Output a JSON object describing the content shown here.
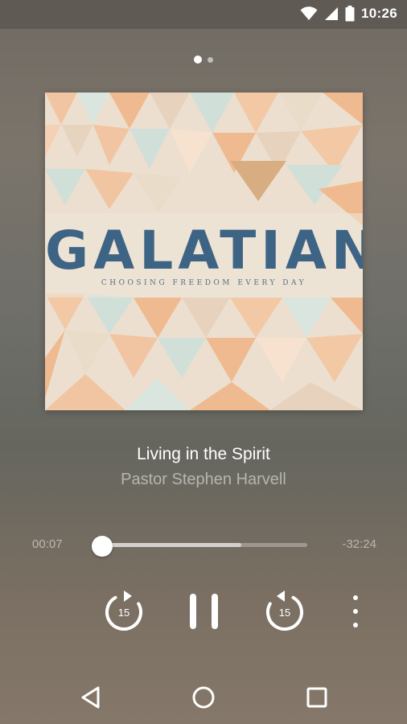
{
  "status_bar": {
    "time": "10:26",
    "icons": [
      "wifi-icon",
      "cell-signal-icon",
      "battery-icon"
    ]
  },
  "pager": {
    "pages": 2,
    "active_index": 0
  },
  "album_art": {
    "title": "GALATIANS",
    "subtitle": "CHOOSING FREEDOM EVERY DAY",
    "colors": {
      "title": "#3d6484",
      "peach": "#f0b98c",
      "cream": "#e9dccb",
      "mint": "#cfe0d8"
    }
  },
  "track": {
    "title": "Living in the Spirit",
    "artist": "Pastor Stephen Harvell"
  },
  "progress": {
    "elapsed": "00:07",
    "remaining": "-32:24",
    "played_fraction": 0.004,
    "buffered_fraction": 0.68
  },
  "controls": {
    "rewind_seconds": "15",
    "forward_seconds": "15",
    "play_state": "pause-icon",
    "more": "more-vert-icon"
  },
  "nav_bar": [
    "back-icon",
    "home-icon",
    "recents-icon"
  ]
}
